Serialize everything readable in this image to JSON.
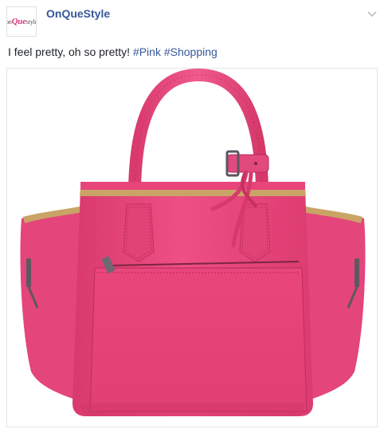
{
  "post": {
    "page_name": "OnQueStyle",
    "logo": {
      "prefix": "on",
      "middle": "Que",
      "suffix": "style"
    },
    "status_text": "I feel pretty, oh so pretty!",
    "hashtags": [
      "#Pink",
      "#Shopping"
    ],
    "menu_icon": "chevron-down-icon",
    "photo_subject": "pink leather handbag"
  },
  "colors": {
    "link": "#365899",
    "bag_pink": "#e8457a",
    "bag_dark": "#c72f60",
    "lining": "#c9a466"
  }
}
